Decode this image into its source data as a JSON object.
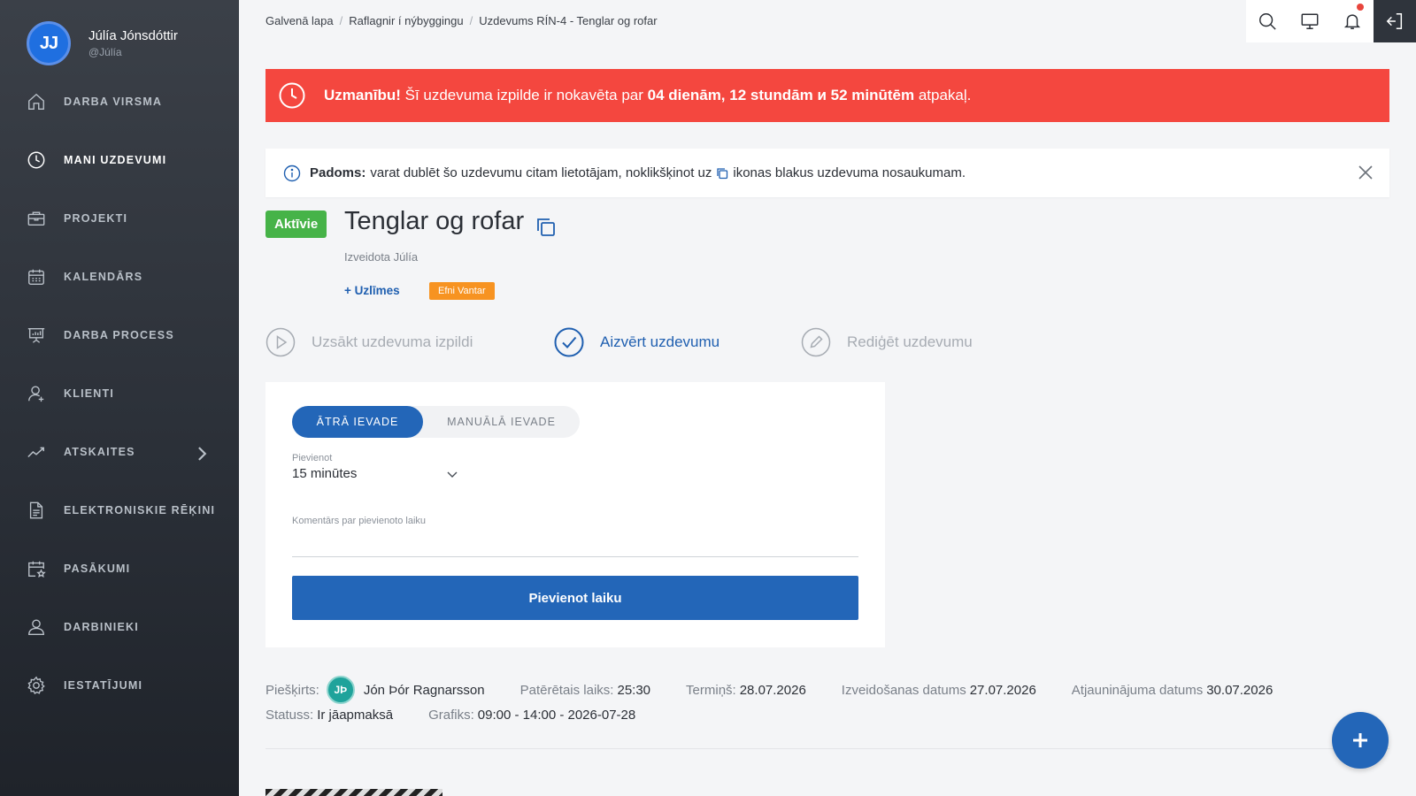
{
  "user": {
    "initials": "JJ",
    "name": "Júlía Jónsdóttir",
    "handle": "@Júlía"
  },
  "sidebar": {
    "items": [
      {
        "label": "DARBA VIRSMA",
        "icon": "home-icon"
      },
      {
        "label": "MANI UZDEVUMI",
        "icon": "clock-icon",
        "active": true
      },
      {
        "label": "PROJEKTI",
        "icon": "briefcase-icon"
      },
      {
        "label": "KALENDĀRS",
        "icon": "calendar-icon"
      },
      {
        "label": "DARBA PROCESS",
        "icon": "presentation-icon"
      },
      {
        "label": "KLIENTI",
        "icon": "user-icon"
      },
      {
        "label": "ATSKAITES",
        "icon": "chart-line-icon"
      },
      {
        "label": "ELEKTRONISKIE RĒĶINI",
        "icon": "document-icon"
      },
      {
        "label": "PASĀKUMI",
        "icon": "calendar-star-icon"
      },
      {
        "label": "DARBINIEKI",
        "icon": "users-icon"
      },
      {
        "label": "IESTATĪJUMI",
        "icon": "gear-icon"
      }
    ]
  },
  "breadcrumb": [
    "Galvenā lapa",
    "Raflagnir í nýbyggingu",
    "Uzdevums RÍN-4 - Tenglar og rofar"
  ],
  "alert": {
    "prefix": "Uzmanību!",
    "text1": " Šī uzdevuma izpilde ir nokavēta par ",
    "duration": "04 dienām, 12 stundām и 52 minūtēm",
    "text2": " atpakaļ."
  },
  "tip": {
    "label": "Padoms:",
    "text1": "varat dublēt šo uzdevumu citam lietotājam, noklikšķinot uz",
    "text2": "ikonas blakus uzdevuma nosaukumam."
  },
  "task": {
    "status": "Aktīvie",
    "title": "Tenglar og rofar",
    "created_by": "Izveidota Júlía",
    "tags_link": "+ Uzlīmes",
    "tag": "Efni Vantar"
  },
  "actions": {
    "start": "Uzsākt uzdevuma izpildi",
    "close": "Aizvērt uzdevumu",
    "edit": "Rediģēt uzdevumu"
  },
  "time_entry": {
    "tab_quick": "ĀTRĀ IEVADE",
    "tab_manual": "MANUĀLĀ IEVADE",
    "add_label": "Pievienot",
    "add_value": "15 minūtes",
    "comment_label": "Komentārs par pievienoto laiku",
    "submit": "Pievienot laiku"
  },
  "meta": {
    "assigned_key": "Piešķirts:",
    "assignee_initials": "JÞ",
    "assignee_name": "Jón Þór Ragnarsson",
    "spent_key": "Patērētais laiks:",
    "spent_val": "25:30",
    "due_key": "Termiņš:",
    "due_val": "28.07.2026",
    "created_key": "Izveidošanas datums",
    "created_val": "27.07.2026",
    "updated_key": "Atjauninājuma datums",
    "updated_val": "30.07.2026",
    "status_key": "Statuss:",
    "status_val": "Ir jāapmaksā",
    "schedule_key": "Grafiks:",
    "schedule_val": "09:00 - 14:00 - 2026-07-28"
  },
  "colors": {
    "accent": "#2366b8",
    "alert": "#f4473f",
    "active_badge": "#46b348",
    "tag": "#f79321",
    "sidebar": "#2a2f37"
  }
}
